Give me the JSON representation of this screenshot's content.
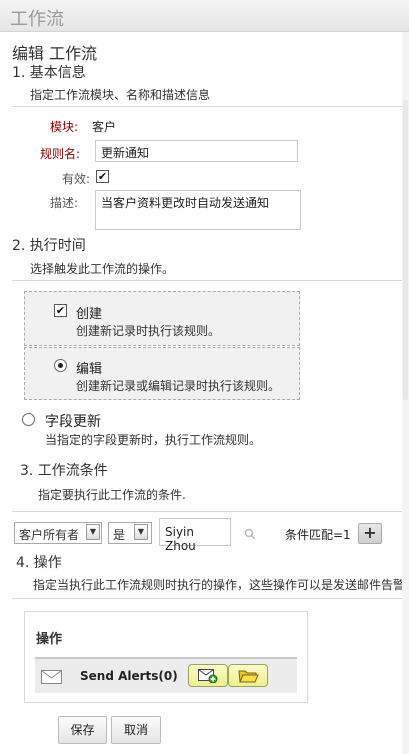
{
  "app": {
    "title": "工作流"
  },
  "page_title": "编辑 工作流",
  "section1": {
    "title": "1. 基本信息",
    "desc": "指定工作流模块、名称和描述信息",
    "module_label": "模块:",
    "module_value": "客户",
    "rule_label": "规则名:",
    "rule_value": "更新通知",
    "active_label": "有效:",
    "active_checked": true,
    "desc_label": "描述:",
    "desc_value": "当客户资料更改时自动发送通知"
  },
  "section2": {
    "title": "2. 执行时间",
    "desc": "选择触发此工作流的操作。",
    "options": [
      {
        "label": "创建",
        "desc": "创建新记录时执行该规则。",
        "control": "checkbox",
        "checked": true
      },
      {
        "label": "编辑",
        "desc": "创建新记录或编辑记录时执行该规则。",
        "control": "radio",
        "checked": true
      },
      {
        "label": "字段更新",
        "desc": "当指定的字段更新时，执行工作流规则。",
        "control": "radio",
        "checked": false
      }
    ]
  },
  "section3": {
    "title": "3. 工作流条件",
    "desc": "指定要执行此工作流的条件.",
    "field_select": "客户所有者",
    "operator_select": "是",
    "value": "Siyin Zhou",
    "lookup_icon": "search-icon",
    "match_text": "条件匹配=1",
    "add_icon": "plus-icon"
  },
  "section4": {
    "title": "4. 操作",
    "desc": "指定当执行此工作流规则时执行的操作，这些操作可以是发送邮件告警",
    "panel_title": "操作",
    "action_label": "Send Alerts(0)",
    "action_icon": "mail-icon"
  },
  "buttons": {
    "save": "保存",
    "cancel": "取消"
  },
  "colors": {
    "required_label": "#8b0000",
    "trigger_bg": "#f1f1f1"
  }
}
